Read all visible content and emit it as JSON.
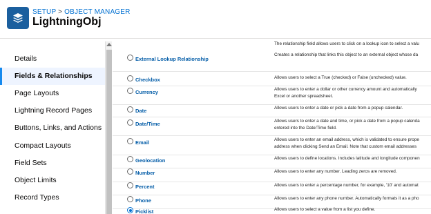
{
  "header": {
    "breadcrumb_setup": "SETUP",
    "breadcrumb_sep": " > ",
    "breadcrumb_object_manager": "OBJECT MANAGER",
    "title": "LightningObj",
    "icon": "layers-icon",
    "icon_bg": "#1b5f9e"
  },
  "sidebar": {
    "items": [
      {
        "label": "Details"
      },
      {
        "label": "Fields & Relationships",
        "active": true
      },
      {
        "label": "Page Layouts"
      },
      {
        "label": "Lightning Record Pages"
      },
      {
        "label": "Buttons, Links, and Actions"
      },
      {
        "label": "Compact Layouts"
      },
      {
        "label": "Field Sets"
      },
      {
        "label": "Object Limits"
      },
      {
        "label": "Record Types"
      }
    ]
  },
  "field_types": {
    "lookup_cont": "The relationship field allows users to click on a lookup icon to select a valu",
    "rows": [
      {
        "label": "External Lookup Relationship",
        "desc1": "Creates a relationship that links this object to an external object whose da",
        "desc2": ""
      },
      {
        "label": "Checkbox",
        "desc1": "Allows users to select a True (checked) or False (unchecked) value.",
        "desc2": ""
      },
      {
        "label": "Currency",
        "desc1": "Allows users to enter a dollar or other currency amount and automatically",
        "desc2": "Excel or another spreadsheet."
      },
      {
        "label": "Date",
        "desc1": "Allows users to enter a date or pick a date from a popup calendar.",
        "desc2": ""
      },
      {
        "label": "Date/Time",
        "desc1": "Allows users to enter a date and time, or pick a date from a popup calenda",
        "desc2": "entered into the Date/Time field."
      },
      {
        "label": "Email",
        "desc1": "Allows users to enter an email address, which is validated to ensure prope",
        "desc2": "address when clicking Send an Email. Note that custom email addresses"
      },
      {
        "label": "Geolocation",
        "desc1": "Allows users to define locations. Includes latitude and longitude componen",
        "desc2": ""
      },
      {
        "label": "Number",
        "desc1": "Allows users to enter any number. Leading zeros are removed.",
        "desc2": ""
      },
      {
        "label": "Percent",
        "desc1": "Allows users to enter a percentage number, for example, '10' and automat",
        "desc2": ""
      },
      {
        "label": "Phone",
        "desc1": "Allows users to enter any phone number. Automatically formats it as a pho",
        "desc2": ""
      },
      {
        "label": "Picklist",
        "desc1": "Allows users to select a value from a list you define.",
        "desc2": "",
        "selected": true
      }
    ]
  }
}
